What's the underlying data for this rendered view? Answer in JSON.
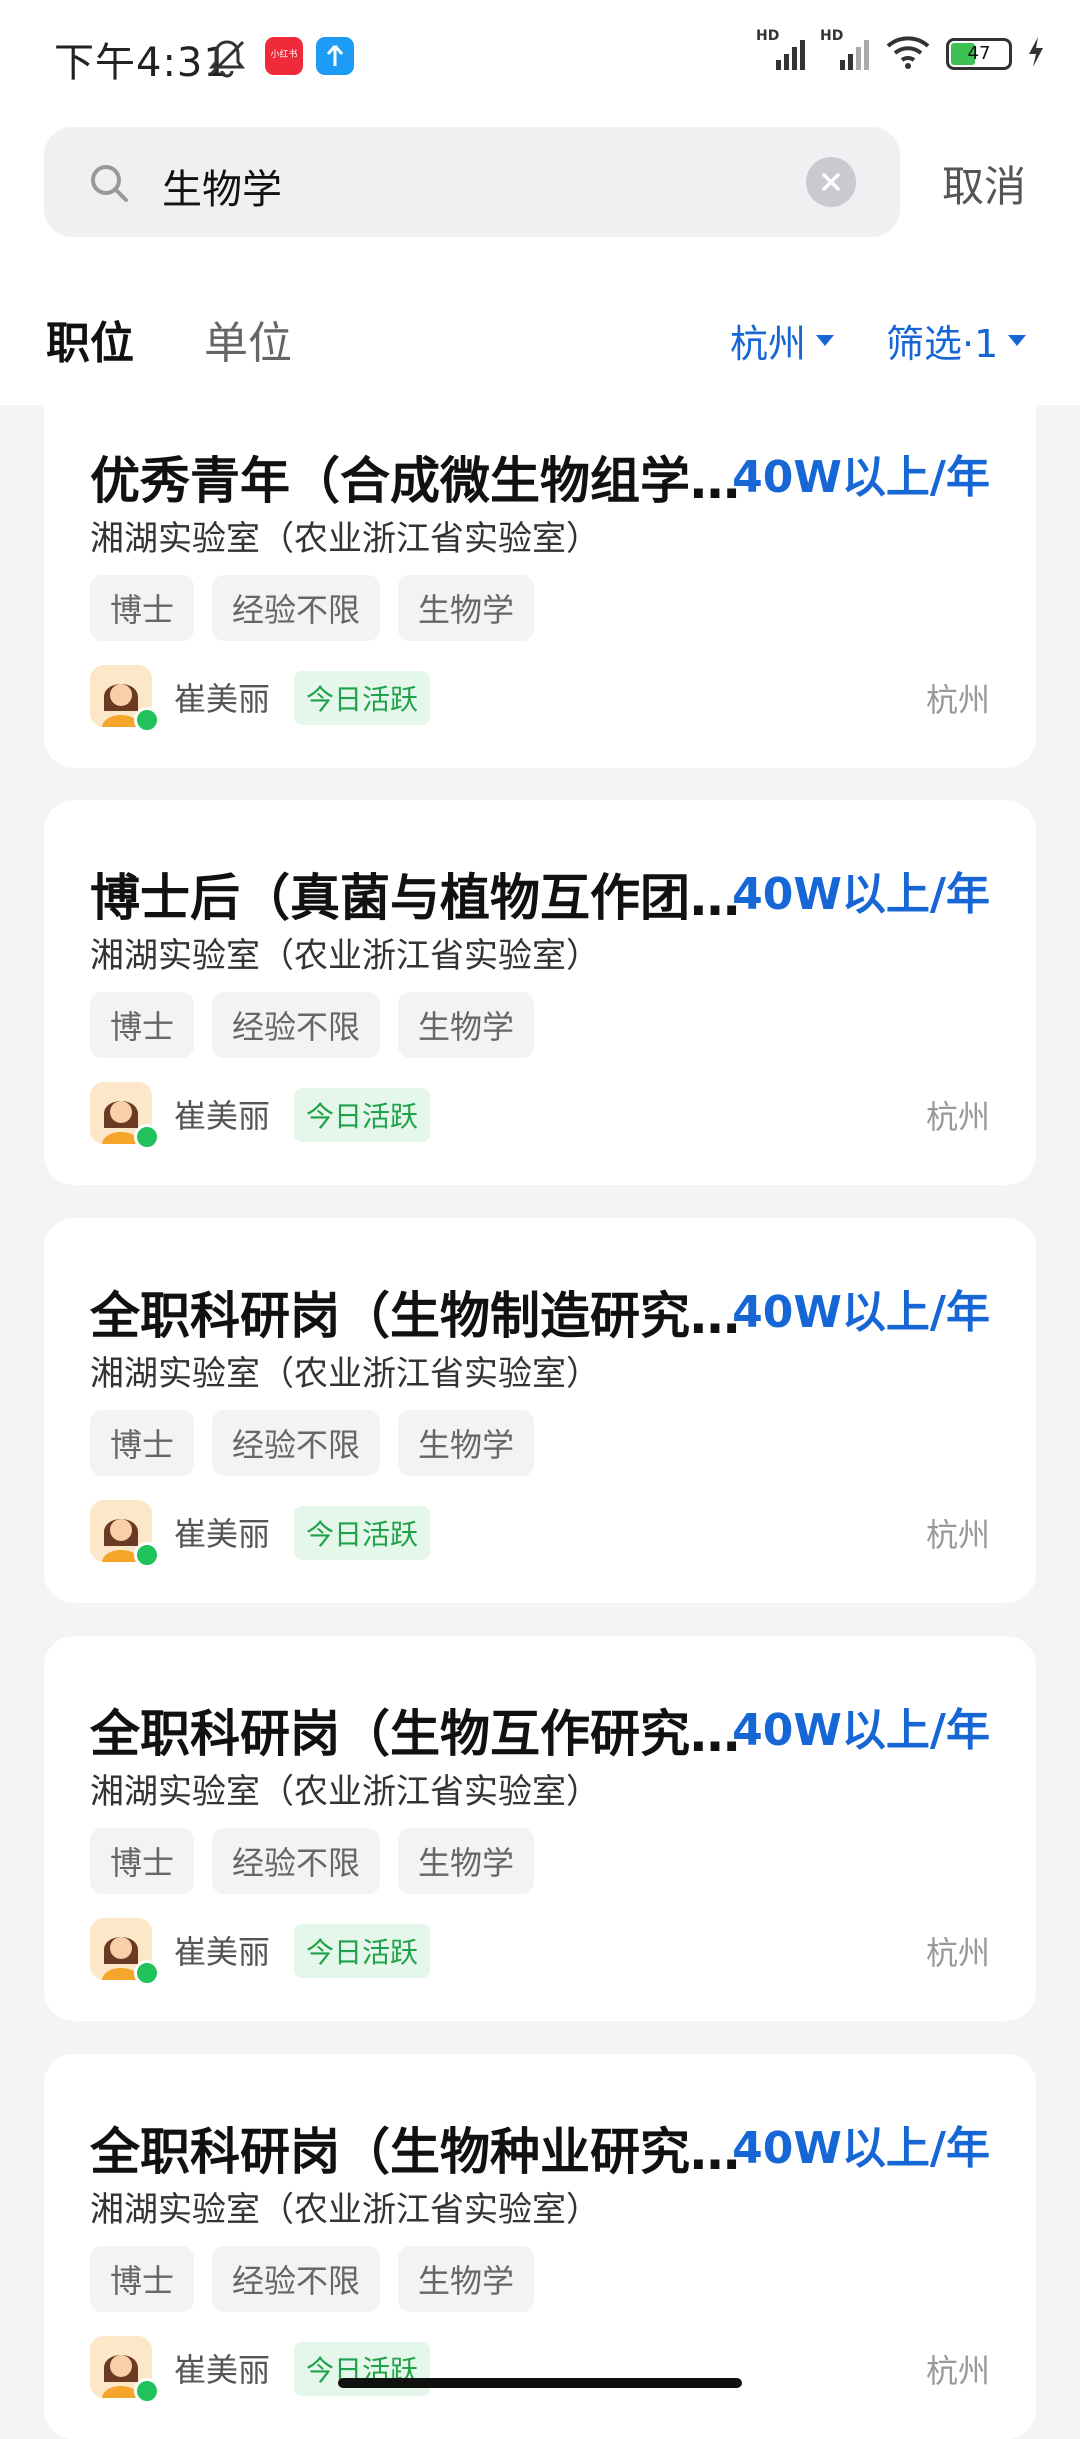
{
  "status_bar": {
    "time": "下午4:31",
    "battery": "47",
    "network_label_1": "HD",
    "network_label_2": "HD",
    "app_badge_1_text": "小红书",
    "icons": [
      "mute-bell-icon",
      "app-badge-icon",
      "upload-app-icon",
      "signal-icon",
      "signal-icon",
      "wifi-icon",
      "battery-icon",
      "charging-icon"
    ]
  },
  "search": {
    "query": "生物学",
    "cancel_label": "取消"
  },
  "tabs": [
    {
      "label": "职位",
      "active": true
    },
    {
      "label": "单位",
      "active": false
    }
  ],
  "filters": {
    "city": "杭州",
    "filter_label": "筛选·1"
  },
  "jobs": [
    {
      "title": "优秀青年（合成微生物组学…",
      "salary": "40W以上/年",
      "company": "湘湖实验室（农业浙江省实验室）",
      "tags": [
        "博士",
        "经验不限",
        "生物学"
      ],
      "recruiter": "崔美丽",
      "active": "今日活跃",
      "city": "杭州"
    },
    {
      "title": "博士后（真菌与植物互作团…",
      "salary": "40W以上/年",
      "company": "湘湖实验室（农业浙江省实验室）",
      "tags": [
        "博士",
        "经验不限",
        "生物学"
      ],
      "recruiter": "崔美丽",
      "active": "今日活跃",
      "city": "杭州"
    },
    {
      "title": "全职科研岗（生物制造研究…",
      "salary": "40W以上/年",
      "company": "湘湖实验室（农业浙江省实验室）",
      "tags": [
        "博士",
        "经验不限",
        "生物学"
      ],
      "recruiter": "崔美丽",
      "active": "今日活跃",
      "city": "杭州"
    },
    {
      "title": "全职科研岗（生物互作研究…",
      "salary": "40W以上/年",
      "company": "湘湖实验室（农业浙江省实验室）",
      "tags": [
        "博士",
        "经验不限",
        "生物学"
      ],
      "recruiter": "崔美丽",
      "active": "今日活跃",
      "city": "杭州"
    },
    {
      "title": "全职科研岗（生物种业研究…",
      "salary": "40W以上/年",
      "company": "湘湖实验室（农业浙江省实验室）",
      "tags": [
        "博士",
        "经验不限",
        "生物学"
      ],
      "recruiter": "崔美丽",
      "active": "今日活跃",
      "city": "杭州"
    }
  ],
  "colors": {
    "accent": "#1766d6",
    "active_green": "#1fa24a",
    "page_bg": "#f3f4f6"
  }
}
